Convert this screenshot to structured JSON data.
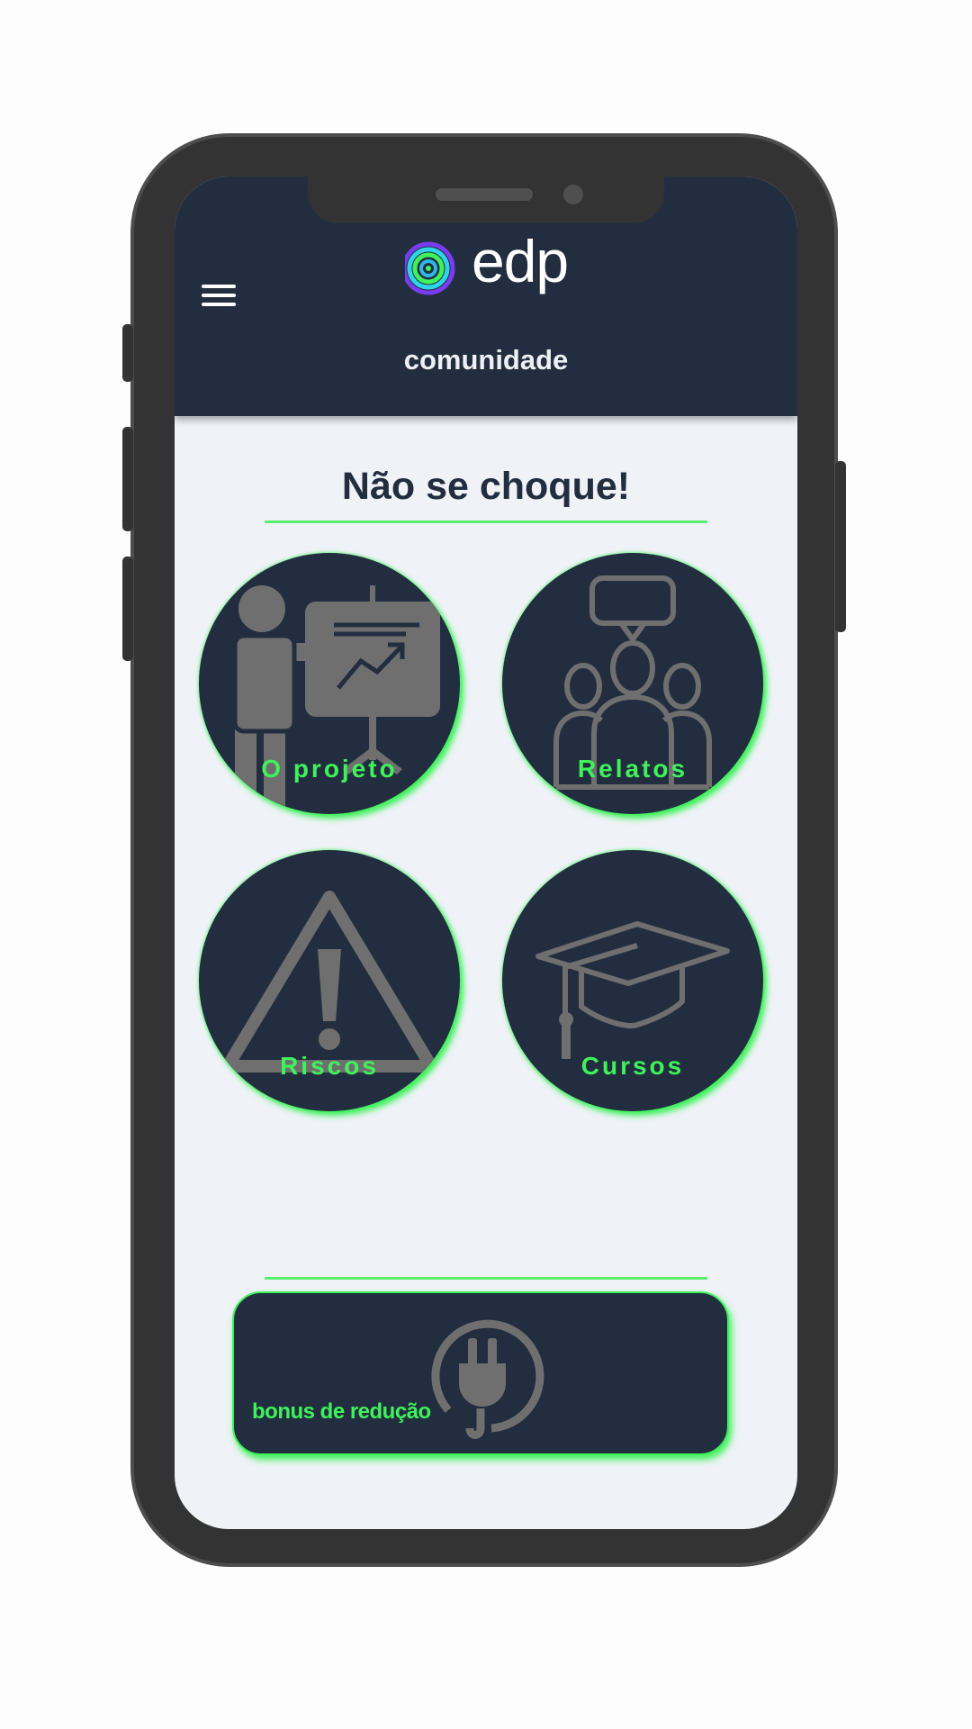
{
  "header": {
    "brand": "edp",
    "subtitle": "comunidade",
    "menu_icon": "hamburger-menu-icon"
  },
  "main": {
    "title": "Não se choque!",
    "tiles": [
      {
        "label": "O projeto",
        "icon": "presentation-icon"
      },
      {
        "label": "Relatos",
        "icon": "people-speech-icon"
      },
      {
        "label": "Riscos",
        "icon": "warning-triangle-icon"
      },
      {
        "label": "Cursos",
        "icon": "graduation-cap-icon"
      }
    ],
    "bonus": {
      "label": "bonus de redução",
      "icon": "power-plug-icon"
    }
  },
  "colors": {
    "header_bg": "#222e3f",
    "screen_bg": "#eff2f7",
    "accent_green": "#3ef25a",
    "icon_gray": "#6f6f6f"
  }
}
